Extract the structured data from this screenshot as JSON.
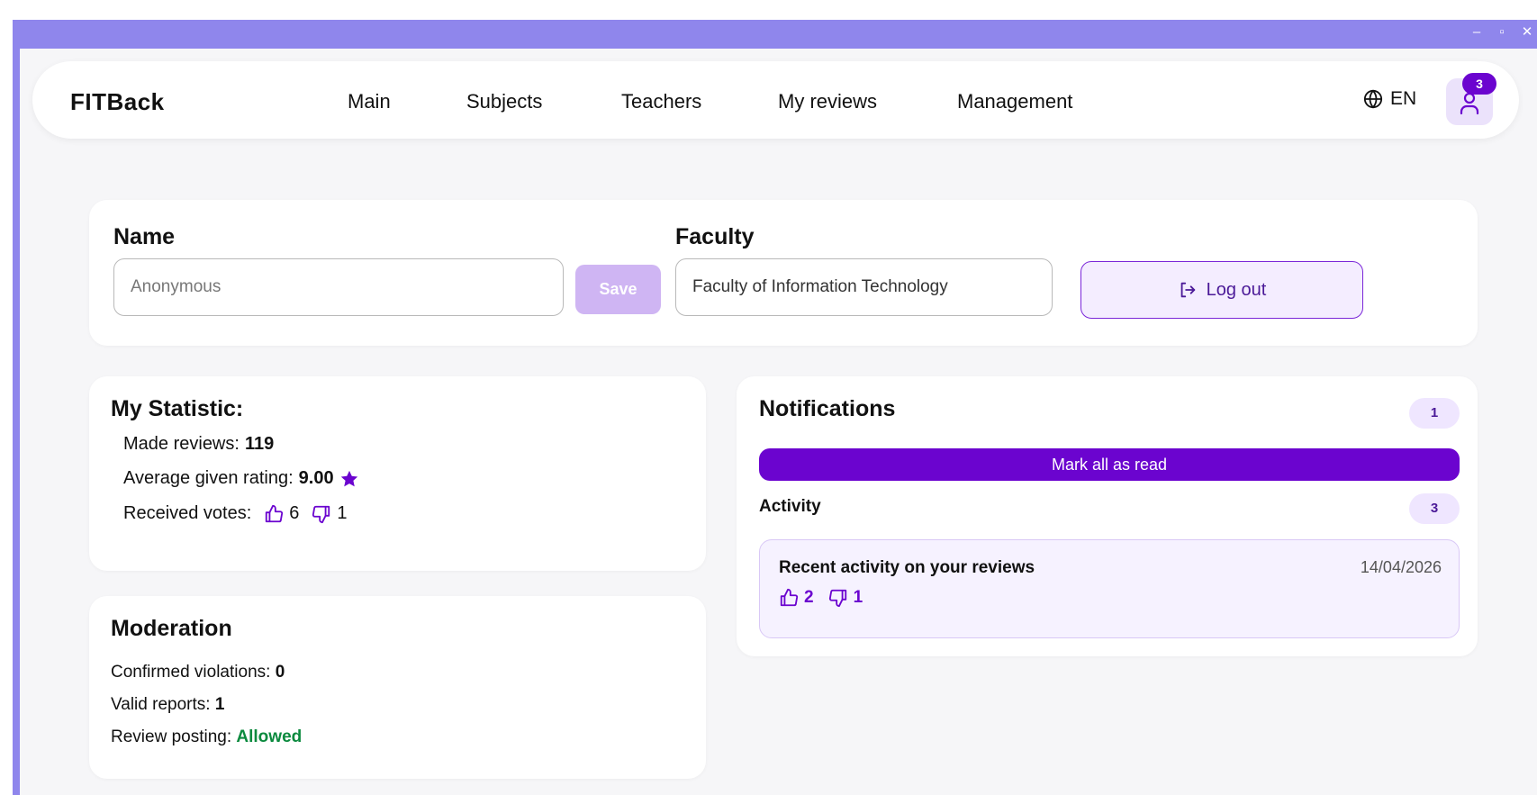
{
  "window": {
    "controls": {
      "minimize": "–",
      "maximize": "▫",
      "close": "✕"
    }
  },
  "navbar": {
    "brand": "FITBack",
    "links": [
      "Main",
      "Subjects",
      "Teachers",
      "My reviews",
      "Management"
    ],
    "language": "EN",
    "notification_count": "3"
  },
  "profile": {
    "name_label": "Name",
    "name_value": "",
    "name_placeholder": "Anonymous",
    "save_label": "Save",
    "faculty_label": "Faculty",
    "faculty_value": "Faculty of Information Technology",
    "logout_label": "Log out"
  },
  "stats": {
    "title": "My Statistic:",
    "made_reviews_label": "Made reviews:",
    "made_reviews_value": "119",
    "avg_rating_label": "Average given rating:",
    "avg_rating_value": "9.00",
    "received_votes_label": "Received votes:",
    "upvotes": "6",
    "downvotes": "1"
  },
  "moderation": {
    "title": "Moderation",
    "violations_label": "Confirmed violations:",
    "violations_value": "0",
    "reports_label": "Valid reports:",
    "reports_value": "1",
    "posting_label": "Review posting:",
    "posting_value": "Allowed"
  },
  "notifications": {
    "title": "Notifications",
    "count": "1",
    "mark_all_label": "Mark all as read",
    "activity_label": "Activity",
    "activity_count": "3",
    "item": {
      "title": "Recent activity on your reviews",
      "date": "14/04/2026",
      "upvotes": "2",
      "downvotes": "1"
    }
  },
  "colors": {
    "window_frame": "#8f86ec",
    "accent": "#6b04cf",
    "save_disabled": "#cfb5f3",
    "allowed": "#0b8a3e"
  },
  "icons": {
    "language": "globe-icon",
    "profile": "user-icon",
    "logout": "logout-icon",
    "rating": "star-icon",
    "upvote": "thumbs-up-icon",
    "downvote": "thumbs-down-icon"
  }
}
